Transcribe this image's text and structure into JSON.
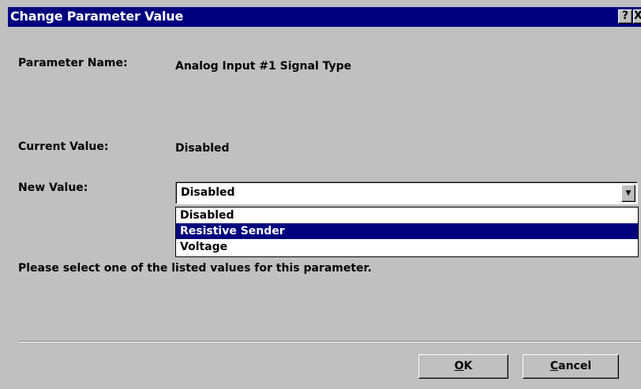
{
  "window": {
    "title": "Change Parameter Value",
    "help_glyph": "?",
    "close_glyph": "X"
  },
  "fields": {
    "parameter_name_label": "Parameter Name:",
    "parameter_name_value": "Analog Input #1 Signal Type",
    "current_value_label": "Current Value:",
    "current_value_value": "Disabled",
    "new_value_label": "New Value:"
  },
  "combo": {
    "selected": "Disabled",
    "arrow_glyph": "▼",
    "options": [
      "Disabled",
      "Resistive Sender",
      "Voltage"
    ],
    "highlighted_index": 1
  },
  "message": "Please select one of the listed values for this parameter.",
  "buttons": {
    "ok_mnemonic": "O",
    "ok_rest": "K",
    "cancel_mnemonic": "C",
    "cancel_rest": "ancel"
  },
  "colors": {
    "titlebar": "#00007f",
    "face": "#c0c0c0",
    "highlight": "#00007f"
  },
  "icons": [
    "help-icon",
    "close-icon",
    "dropdown-arrow-icon"
  ]
}
